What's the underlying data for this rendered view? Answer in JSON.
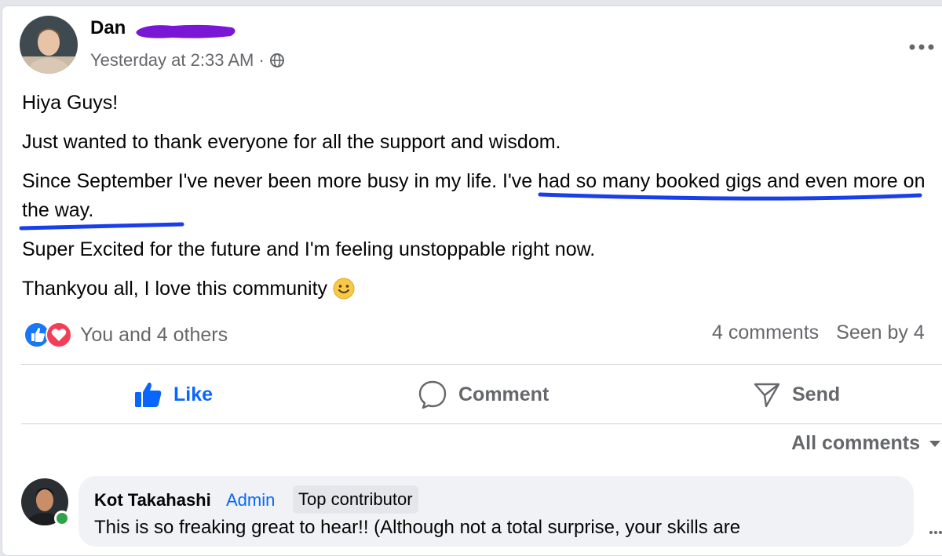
{
  "post": {
    "author_name": "Dan",
    "timestamp": "Yesterday at 2:33 AM · ",
    "privacy_icon": "globe-icon",
    "paragraphs": {
      "p1": "Hiya Guys!",
      "p2": "Just wanted to thank everyone for all the support and wisdom.",
      "p3a": "Since September I've never been more busy in my life. ",
      "p3b": "I've had so many booked gigs and even more on the way",
      "p3c": ".",
      "p4": "Super Excited for the future and I'm feeling unstoppable right now.",
      "p5": "Thankyou all, I love this community "
    },
    "reactions_text": "You and 4 others",
    "comments_count": "4 comments",
    "seen_by": "Seen by 4",
    "actions": {
      "like": "Like",
      "comment": "Comment",
      "send": "Send"
    },
    "sort_label": "All comments"
  },
  "comment": {
    "author": "Kot Takahashi",
    "badge_admin": "Admin",
    "badge_top": "Top contributor",
    "text": "This is so freaking great to hear!! (Although not a total surprise, your skills are"
  },
  "colors": {
    "link_blue": "#0866ff",
    "secondary_text": "#65676b",
    "underline_marker": "#1a3ee8",
    "redaction": "#7a17d6",
    "online": "#31a24c"
  }
}
